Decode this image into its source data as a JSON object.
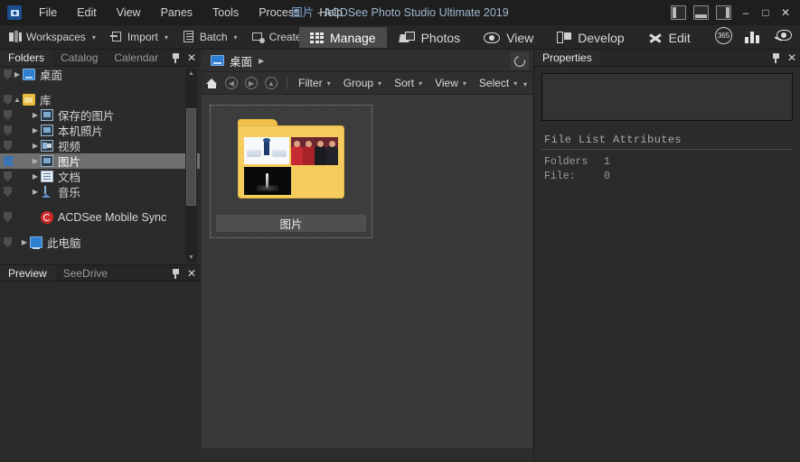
{
  "window": {
    "title_zh": "图片",
    "title_sep": " - ",
    "title_app": "ACDSee Photo Studio Ultimate 2019",
    "app_icon": "acdsee-logo-icon",
    "panel_toggles": [
      {
        "name": "toggle-left-panel",
        "icon": "panel-left-icon"
      },
      {
        "name": "toggle-bottom-panel",
        "icon": "panel-bottom-icon"
      },
      {
        "name": "toggle-right-panel",
        "icon": "panel-right-icon"
      }
    ],
    "controls": {
      "minimize": "–",
      "maximize": "□",
      "close": "✕"
    }
  },
  "menubar": {
    "items": [
      {
        "label": "File"
      },
      {
        "label": "Edit"
      },
      {
        "label": "View"
      },
      {
        "label": "Panes"
      },
      {
        "label": "Tools"
      },
      {
        "label": "Process"
      },
      {
        "label": "Help"
      }
    ]
  },
  "toolbar": {
    "buttons": [
      {
        "label": "Workspaces",
        "icon": "workspaces-icon",
        "caret": "▾"
      },
      {
        "label": "Import",
        "icon": "import-icon",
        "caret": "▾"
      },
      {
        "label": "Batch",
        "icon": "batch-icon",
        "caret": "▾"
      },
      {
        "label": "Create",
        "icon": "create-icon",
        "caret": "▾"
      }
    ],
    "overflow": "»"
  },
  "modes": {
    "tabs": [
      {
        "label": "Manage",
        "icon": "grid-icon",
        "active": true
      },
      {
        "label": "Photos",
        "icon": "photos-icon",
        "active": false
      },
      {
        "label": "View",
        "icon": "eye-icon",
        "active": false
      },
      {
        "label": "Develop",
        "icon": "develop-icon",
        "active": false
      },
      {
        "label": "Edit",
        "icon": "edit-icon",
        "active": false
      }
    ],
    "right_icons": [
      {
        "name": "acdsee-365-icon",
        "label": "365"
      },
      {
        "name": "histogram-icon"
      },
      {
        "name": "loupe-icon"
      }
    ]
  },
  "left_panel": {
    "tabs": [
      {
        "label": "Folders",
        "active": true
      },
      {
        "label": "Catalog",
        "active": false
      },
      {
        "label": "Calendar",
        "active": false
      }
    ],
    "pin": "pin-icon",
    "close": "✕",
    "tree": [
      {
        "label": "桌面",
        "icon": "desktop-icon",
        "arrow": "▶",
        "indent": 1,
        "selected": false
      },
      {
        "gap": true
      },
      {
        "label": "库",
        "icon": "library-folder-icon",
        "arrow": "▲",
        "indent": 1,
        "selected": false
      },
      {
        "label": "保存的图片",
        "icon": "pictures-icon",
        "arrow": "▶",
        "indent": 2,
        "selected": false
      },
      {
        "label": "本机照片",
        "icon": "pictures-icon",
        "arrow": "▶",
        "indent": 2,
        "selected": false
      },
      {
        "label": "视频",
        "icon": "videos-icon",
        "arrow": "▶",
        "indent": 2,
        "selected": false
      },
      {
        "label": "图片",
        "icon": "pictures-icon",
        "arrow": "▶",
        "indent": 2,
        "selected": true
      },
      {
        "label": "文档",
        "icon": "documents-icon",
        "arrow": "▶",
        "indent": 2,
        "selected": false
      },
      {
        "label": "音乐",
        "icon": "music-icon",
        "arrow": "▶",
        "indent": 2,
        "selected": false
      },
      {
        "gap": true
      },
      {
        "label": "ACDSee Mobile Sync",
        "icon": "mobile-sync-icon",
        "arrow": "",
        "indent": 2,
        "selected": false
      },
      {
        "gap": true
      },
      {
        "label": "此电脑",
        "icon": "this-pc-icon",
        "arrow": "▶",
        "indent": 1,
        "selected": false
      }
    ],
    "bottom_tabs": [
      {
        "label": "Preview",
        "active": true
      },
      {
        "label": "SeeDrive",
        "active": false
      }
    ]
  },
  "center": {
    "breadcrumb": {
      "icon": "desktop-icon",
      "label": "桌面",
      "arrow": "▶",
      "refresh": "refresh-icon"
    },
    "nav": {
      "home": "home-icon",
      "back": "◀",
      "forward": "▶",
      "up": "▲",
      "menus": [
        {
          "label": "Filter",
          "caret": "▾"
        },
        {
          "label": "Group",
          "caret": "▾"
        },
        {
          "label": "Sort",
          "caret": "▾"
        },
        {
          "label": "View",
          "caret": "▾"
        },
        {
          "label": "Select",
          "caret": "▾"
        }
      ],
      "overflow": "▾"
    },
    "items": [
      {
        "label": "图片",
        "type": "folder",
        "selected": true,
        "thumbnails": 3
      }
    ]
  },
  "right_panel": {
    "tabs": [
      {
        "label": "Properties",
        "active": true
      }
    ],
    "pin": "pin-icon",
    "close": "✕",
    "preview_box_value": "",
    "section_title": "File List Attributes",
    "attributes": [
      {
        "key": "Folders",
        "value": "1"
      },
      {
        "key": "File:",
        "value": "0"
      }
    ]
  },
  "colors": {
    "window_bg": "#2b2b2b",
    "titlebar_bg": "#1e1e1e",
    "accent_selection": "#6f6f6f",
    "folder_yellow": "#f5cd5e",
    "title_text": "#9fb6cf",
    "sync_red": "#d02a2a"
  }
}
